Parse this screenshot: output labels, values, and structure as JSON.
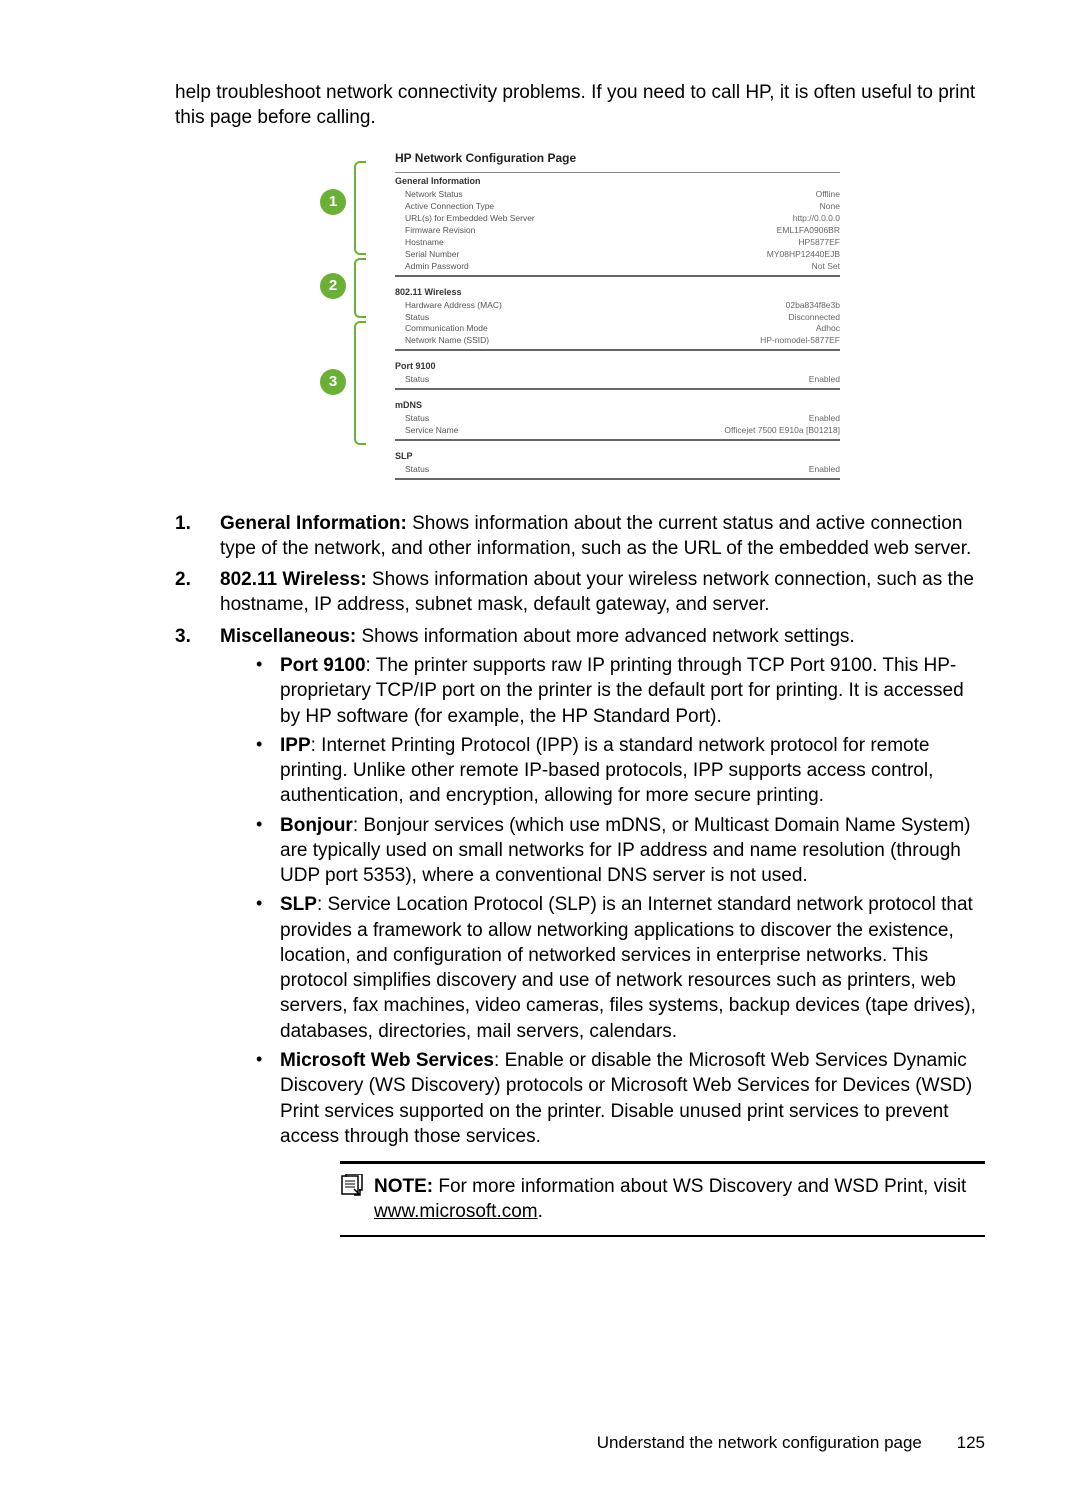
{
  "intro": "help troubleshoot network connectivity problems. If you need to call HP, it is often useful to print this page before calling.",
  "figure": {
    "title": "HP Network Configuration Page",
    "callouts": [
      "1",
      "2",
      "3"
    ],
    "sections": [
      {
        "title": "General Information",
        "rows": [
          {
            "l": "Network Status",
            "r": "Offline"
          },
          {
            "l": "Active Connection Type",
            "r": "None"
          },
          {
            "l": "URL(s) for Embedded Web Server",
            "r": "http://0.0.0.0"
          },
          {
            "l": "Firmware Revision",
            "r": "EML1FA0906BR"
          },
          {
            "l": "Hostname",
            "r": "HP5877EF"
          },
          {
            "l": "Serial Number",
            "r": "MY08HP12440EJB"
          },
          {
            "l": "Admin Password",
            "r": "Not Set"
          }
        ]
      },
      {
        "title": "802.11 Wireless",
        "rows": [
          {
            "l": "Hardware Address (MAC)",
            "r": "02ba834f8e3b"
          },
          {
            "l": "Status",
            "r": "Disconnected"
          },
          {
            "l": "Communication Mode",
            "r": "Adhoc"
          },
          {
            "l": "Network Name (SSID)",
            "r": "HP-nomodel-5877EF"
          }
        ]
      },
      {
        "title": "Port 9100",
        "rows": [
          {
            "l": "Status",
            "r": "Enabled"
          }
        ]
      },
      {
        "title": "mDNS",
        "rows": [
          {
            "l": "Status",
            "r": "Enabled"
          },
          {
            "l": "Service Name",
            "r": "Officejet 7500 E910a [B01218]"
          }
        ]
      },
      {
        "title": "SLP",
        "rows": [
          {
            "l": "Status",
            "r": "Enabled"
          }
        ]
      }
    ]
  },
  "list": {
    "item1": {
      "num": "1.",
      "label": "General Information:",
      "text": " Shows information about the current status and active connection type of the network, and other information, such as the URL of the embedded web server."
    },
    "item2": {
      "num": "2.",
      "label": "802.11 Wireless:",
      "text": " Shows information about your wireless network connection, such as the hostname, IP address, subnet mask, default gateway, and server."
    },
    "item3": {
      "num": "3.",
      "label": "Miscellaneous:",
      "text": " Shows information about more advanced network settings."
    },
    "sub": {
      "port": {
        "label": "Port 9100",
        "text": ": The printer supports raw IP printing through TCP Port 9100. This HP-proprietary TCP/IP port on the printer is the default port for printing. It is accessed by HP software (for example, the HP Standard Port)."
      },
      "ipp": {
        "label": "IPP",
        "text": ": Internet Printing Protocol (IPP) is a standard network protocol for remote printing. Unlike other remote IP-based protocols, IPP supports access control, authentication, and encryption, allowing for more secure printing."
      },
      "bonjour": {
        "label": "Bonjour",
        "text": ": Bonjour services (which use mDNS, or Multicast Domain Name System) are typically used on small networks for IP address and name resolution (through UDP port 5353), where a conventional DNS server is not used."
      },
      "slp": {
        "label": "SLP",
        "text": ": Service Location Protocol (SLP) is an Internet standard network protocol that provides a framework to allow networking applications to discover the existence, location, and configuration of networked services in enterprise networks. This protocol simplifies discovery and use of network resources such as printers, web servers, fax machines, video cameras, files systems, backup devices (tape drives), databases, directories, mail servers, calendars."
      },
      "mws": {
        "label": "Microsoft Web Services",
        "text": ": Enable or disable the Microsoft Web Services Dynamic Discovery (WS Discovery) protocols or Microsoft Web Services for Devices (WSD) Print services supported on the printer. Disable unused print services to prevent access through those services."
      }
    }
  },
  "note": {
    "label": "NOTE:",
    "text": "  For more information about WS Discovery and WSD Print, visit ",
    "link": "www.microsoft.com",
    "tail": "."
  },
  "footer": {
    "text": "Understand the network configuration page",
    "page": "125"
  }
}
